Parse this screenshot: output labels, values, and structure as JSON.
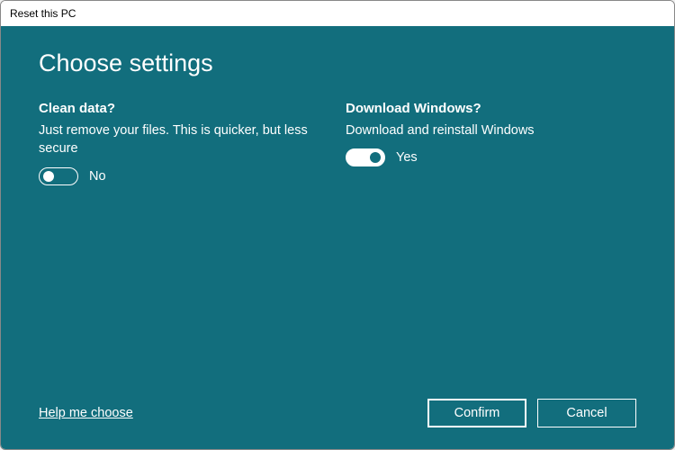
{
  "window": {
    "title": "Reset this PC"
  },
  "page": {
    "heading": "Choose settings"
  },
  "options": {
    "clean_data": {
      "heading": "Clean data?",
      "description": "Just remove your files. This is quicker, but less secure",
      "toggle_state": "off",
      "toggle_label": "No"
    },
    "download_windows": {
      "heading": "Download Windows?",
      "description": "Download and reinstall Windows",
      "toggle_state": "on",
      "toggle_label": "Yes"
    }
  },
  "footer": {
    "help_link": "Help me choose",
    "confirm": "Confirm",
    "cancel": "Cancel"
  }
}
